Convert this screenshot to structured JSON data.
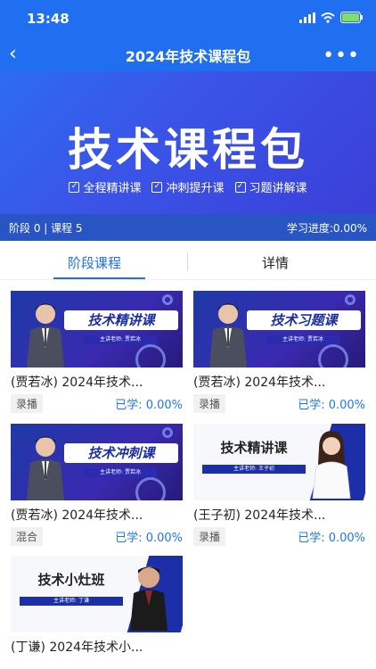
{
  "status": {
    "time": "13:48"
  },
  "nav": {
    "title": "2024年技术课程包"
  },
  "banner": {
    "headline": "技术课程包",
    "features": [
      "全程精讲课",
      "冲刺提升课",
      "习题讲解课"
    ]
  },
  "info": {
    "left": "阶段 0 | 课程 5",
    "right": "学习进度:0.00%"
  },
  "tabs": [
    {
      "label": "阶段课程"
    },
    {
      "label": "详情"
    }
  ],
  "courses": [
    {
      "thumb_title": "技术精讲课",
      "teacher": "主讲老师: 贾若冰",
      "name": "(贾若冰) 2024年技术...",
      "tag": "录播",
      "progress": "已学: 0.00%"
    },
    {
      "thumb_title": "技术习题课",
      "teacher": "主讲老师: 贾若冰",
      "name": "(贾若冰) 2024年技术...",
      "tag": "录播",
      "progress": "已学: 0.00%"
    },
    {
      "thumb_title": "技术冲刺课",
      "teacher": "主讲老师: 贾若冰",
      "name": "(贾若冰) 2024年技术...",
      "tag": "混合",
      "progress": "已学: 0.00%"
    },
    {
      "thumb_title": "技术精讲课",
      "teacher": "主讲老师: 王子初",
      "name": "(王子初) 2024年技术...",
      "tag": "录播",
      "progress": "已学: 0.00%"
    },
    {
      "thumb_title": "技术小灶班",
      "teacher": "主讲老师: 丁谦",
      "name": "(丁谦) 2024年技术小..."
    }
  ]
}
